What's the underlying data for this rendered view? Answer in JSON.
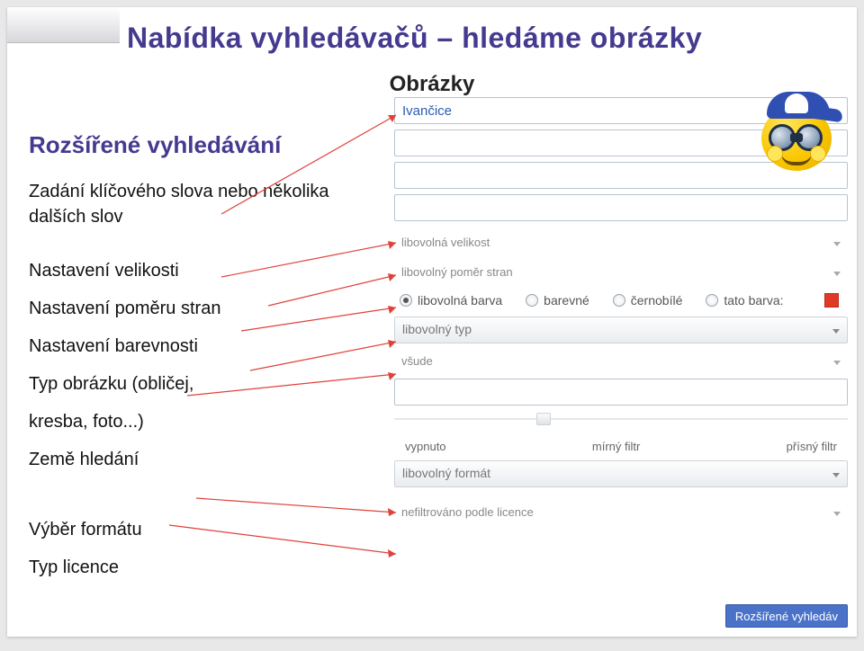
{
  "title": "Nabídka vyhledávačů – hledáme obrázky",
  "subtitle": "Obrázky",
  "left": {
    "heading": "Rozšířené vyhledávání",
    "keyword": "Zadání klíčového slova nebo několika dalších slov",
    "size": "Nastavení velikosti",
    "aspect": "Nastavení poměru stran",
    "color": "Nastavení barevnosti",
    "type_line1": "Typ obrázku (obličej,",
    "type_line2": "kresba, foto...)",
    "country": "Země hledání",
    "format": "Výběr formátu",
    "license": "Typ licence"
  },
  "form": {
    "keyword_value": "Ivančice",
    "size": "libovolná velikost",
    "aspect": "libovolný poměr stran",
    "colors": {
      "any": "libovolná barva",
      "colored": "barevné",
      "bw": "černobílé",
      "this": "tato barva:",
      "swatch_hex": "#e03a26"
    },
    "type": "libovolný typ",
    "where": "všude",
    "safesearch": {
      "left": "vypnuto",
      "mid": "mírný filtr",
      "right": "přísný filtr"
    },
    "format": "libovolný formát",
    "license": "nefiltrováno podle licence",
    "submit": "Rozšířené vyhledáv"
  }
}
